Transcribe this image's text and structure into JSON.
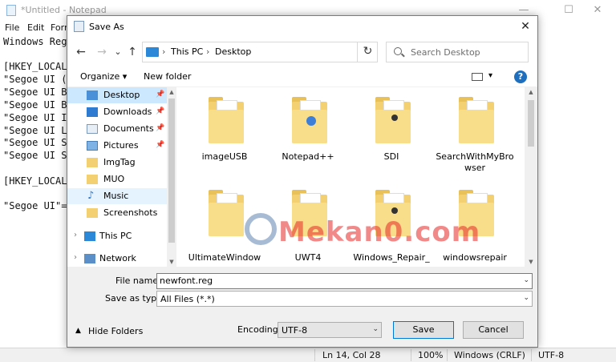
{
  "notepad": {
    "title": "*Untitled - Notepad",
    "menu": [
      "File",
      "Edit",
      "Form"
    ],
    "lines": [
      "Windows Regi",
      "",
      "[HKEY_LOCAL_",
      "\"Segoe UI (T",
      "\"Segoe UI Bo",
      "\"Segoe UI Bo",
      "\"Segoe UI It",
      "\"Segoe UI Li",
      "\"Segoe UI Se",
      "\"Segoe UI Sy",
      "",
      "[HKEY_LOCAL_",
      "",
      "\"Segoe UI\"=\""
    ],
    "status": {
      "position": "Ln 14, Col 28",
      "zoom": "100%",
      "line_ending": "Windows (CRLF)",
      "encoding": "UTF-8"
    },
    "controls": {
      "minimize": "—",
      "maximize": "☐",
      "close": "✕"
    }
  },
  "dialog": {
    "title": "Save As",
    "close": "✕",
    "nav": {
      "back": "←",
      "forward": "→",
      "recent": "⌄",
      "up": "↑"
    },
    "address": {
      "crumbs": [
        "This PC",
        "Desktop"
      ],
      "sep": "›",
      "drop": "⌄",
      "refresh": "↻"
    },
    "search": {
      "placeholder": "Search Desktop"
    },
    "toolbar": {
      "organize": "Organize ▾",
      "new_folder": "New folder",
      "view_drop": "▾",
      "help": "?"
    },
    "nav_pane": [
      {
        "label": "Desktop",
        "pinned": true,
        "selected": true
      },
      {
        "label": "Downloads",
        "pinned": true
      },
      {
        "label": "Documents",
        "pinned": true
      },
      {
        "label": "Pictures",
        "pinned": true
      },
      {
        "label": "ImgTag"
      },
      {
        "label": "MUO"
      },
      {
        "label": "Music",
        "hover": true
      },
      {
        "label": "Screenshots"
      },
      {
        "label": "This PC",
        "expander": true
      },
      {
        "label": "Network",
        "expander": true
      }
    ],
    "files": [
      {
        "name": "imageUSB"
      },
      {
        "name": "Notepad++",
        "badge": "blue"
      },
      {
        "name": "SDI",
        "badge": "dark"
      },
      {
        "name": "SearchWithMyBrowser"
      },
      {
        "name": "UltimateWindow"
      },
      {
        "name": "UWT4"
      },
      {
        "name": "Windows_Repair_",
        "badge": "dark"
      },
      {
        "name": "windowsrepair"
      }
    ],
    "file_name": {
      "label": "File name:",
      "value": "newfont.reg"
    },
    "save_as_type": {
      "label": "Save as type:",
      "value": "All Files  (*.*)"
    },
    "hide_folders": "Hide Folders",
    "encoding": {
      "label": "Encoding:",
      "value": "UTF-8"
    },
    "save": "Save",
    "cancel": "Cancel"
  },
  "watermark": "Mekan0.com",
  "colors": {
    "folder": "#f3d173",
    "selection": "#cce8ff",
    "accent": "#0078d7"
  }
}
